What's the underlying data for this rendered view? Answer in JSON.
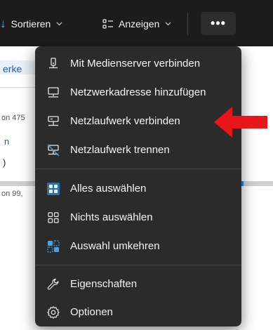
{
  "toolbar": {
    "sort_label": "Sortieren",
    "view_label": "Anzeigen",
    "more_label": "•••"
  },
  "background": {
    "link_fragment": "erke",
    "size_fragment_1": "on 475",
    "char_1": "n",
    "char_2": ")",
    "size_fragment_2": "on 99,"
  },
  "menu": {
    "items": [
      {
        "label": "Mit Medienserver verbinden",
        "icon": "media-server-icon"
      },
      {
        "label": "Netzwerkadresse hinzufügen",
        "icon": "network-address-icon"
      },
      {
        "label": "Netzlaufwerk verbinden",
        "icon": "map-network-drive-icon"
      },
      {
        "label": "Netzlaufwerk trennen",
        "icon": "disconnect-network-drive-icon"
      },
      {
        "label": "Alles auswählen",
        "icon": "select-all-icon"
      },
      {
        "label": "Nichts auswählen",
        "icon": "select-none-icon"
      },
      {
        "label": "Auswahl umkehren",
        "icon": "invert-selection-icon"
      },
      {
        "label": "Eigenschaften",
        "icon": "wrench-icon"
      },
      {
        "label": "Optionen",
        "icon": "gear-icon"
      }
    ]
  },
  "colors": {
    "menu_bg": "#2b2b2b",
    "toolbar_bg": "#1c1c1c",
    "accent": "#4ca0e0",
    "arrow": "#e8161b"
  }
}
